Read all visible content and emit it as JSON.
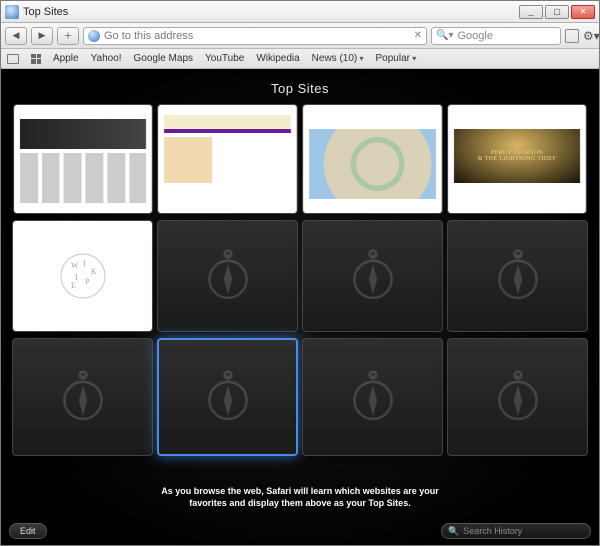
{
  "window": {
    "title": "Top Sites"
  },
  "win_controls": {
    "min": "_",
    "max": "▢",
    "close": "✕"
  },
  "nav": {
    "back": "◀",
    "forward": "▶",
    "add": "＋"
  },
  "url_bar": {
    "placeholder": "Go to this address",
    "reload_glyph": "✕"
  },
  "searchbox": {
    "engine": "Google",
    "mag": "🔍"
  },
  "toolbar_more": {
    "newpage": "▫",
    "gear": "⚙"
  },
  "bookmarks": {
    "items": [
      {
        "label": "Apple"
      },
      {
        "label": "Yahoo!"
      },
      {
        "label": "Google Maps"
      },
      {
        "label": "YouTube"
      },
      {
        "label": "Wikipedia"
      },
      {
        "label": "News (10)",
        "dropdown": true
      },
      {
        "label": "Popular",
        "dropdown": true
      }
    ]
  },
  "page": {
    "title": "Top Sites",
    "hint_line1": "As you browse the web, Safari will learn which websites are your",
    "hint_line2": "favorites and display them above as your Top Sites."
  },
  "tiles": {
    "row1": [
      {
        "name": "apple",
        "kind": "thumb"
      },
      {
        "name": "yahoo",
        "kind": "thumb"
      },
      {
        "name": "google-maps",
        "kind": "thumb"
      },
      {
        "name": "youtube",
        "kind": "thumb"
      }
    ],
    "row2": [
      {
        "name": "wikipedia",
        "kind": "thumb"
      },
      {
        "name": "empty-1",
        "kind": "empty"
      },
      {
        "name": "empty-2",
        "kind": "empty"
      },
      {
        "name": "empty-3",
        "kind": "empty"
      }
    ],
    "row3": [
      {
        "name": "empty-4",
        "kind": "empty"
      },
      {
        "name": "empty-5",
        "kind": "empty",
        "selected": true
      },
      {
        "name": "empty-6",
        "kind": "empty"
      },
      {
        "name": "empty-7",
        "kind": "empty"
      }
    ]
  },
  "footer": {
    "edit": "Edit",
    "history_placeholder": "Search History"
  }
}
